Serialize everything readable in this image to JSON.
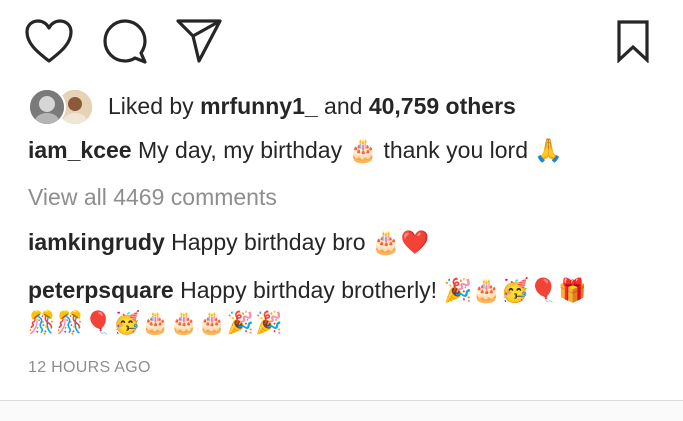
{
  "likes": {
    "prefix": "Liked by",
    "user": "mrfunny1_",
    "conjunction": "and",
    "others": "40,759 others"
  },
  "caption": {
    "username": "iam_kcee",
    "text": "My day, my birthday",
    "emoji_1": "🎂",
    "text_2": "thank you lord",
    "emoji_2": "🙏"
  },
  "view_comments": "View all 4469 comments",
  "comments": [
    {
      "username": "iamkingrudy",
      "text": "Happy birthday bro",
      "emojis": "🎂❤️"
    },
    {
      "username": "peterpsquare",
      "text": "Happy birthday brotherly!",
      "emojis": "🎉🎂🥳🎈🎁",
      "emojis_line2": "🎊🎊🎈🥳🎂🎂🎂🎉🎉"
    }
  ],
  "timestamp": "12 HOURS AGO",
  "icons": {
    "like": "heart-icon",
    "comment": "comment-icon",
    "share": "send-icon",
    "save": "bookmark-icon"
  },
  "colors": {
    "text": "#262626",
    "secondary": "#8e8e8e",
    "divider": "#dbdbdb"
  }
}
